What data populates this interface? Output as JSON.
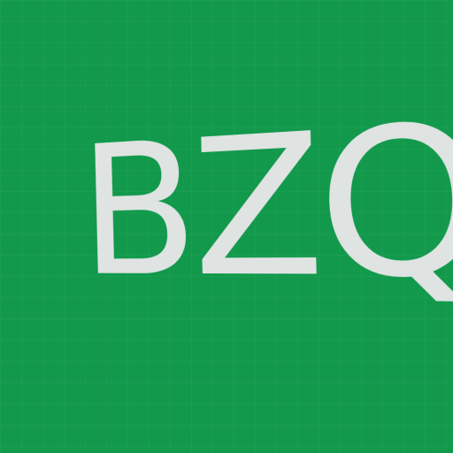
{
  "logo": {
    "text": "BZQ",
    "text_color": "#dfe3e2",
    "background_color": "#12994c"
  }
}
